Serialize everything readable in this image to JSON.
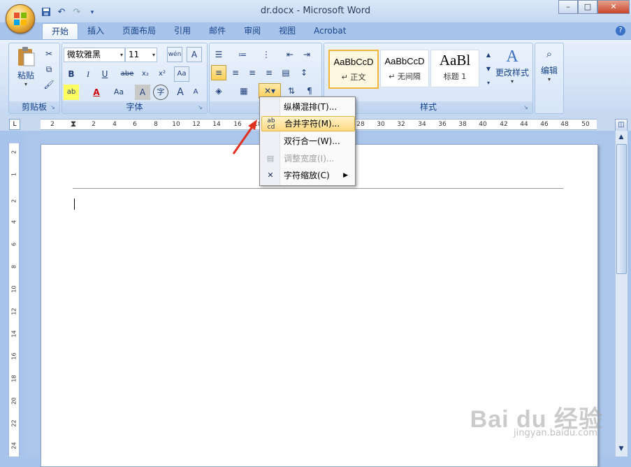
{
  "window": {
    "title": "dr.docx - Microsoft Word",
    "minimize": "0",
    "maximize": "□",
    "close": "✕"
  },
  "quick_access": {
    "save_icon": "save-icon",
    "undo_icon": "undo-icon",
    "redo_icon": "redo-icon",
    "customize_icon": "customize-icon"
  },
  "tabs": [
    {
      "label": "开始",
      "active": true
    },
    {
      "label": "插入"
    },
    {
      "label": "页面布局"
    },
    {
      "label": "引用"
    },
    {
      "label": "邮件"
    },
    {
      "label": "审阅"
    },
    {
      "label": "视图"
    },
    {
      "label": "Acrobat"
    }
  ],
  "ribbon": {
    "clipboard": {
      "label": "剪贴板",
      "paste": "粘贴"
    },
    "font": {
      "label": "字体",
      "font_name": "微软雅黑",
      "font_size": "11",
      "bold": "B",
      "italic": "I",
      "underline": "U",
      "strike": "abe",
      "subscript": "x₂",
      "superscript": "x²",
      "clear": "Aa",
      "char_shading": "A",
      "grow": "A",
      "shrink": "A",
      "wen": "wén",
      "change_case": "Aa",
      "circled": "字"
    },
    "paragraph": {
      "label": "段"
    },
    "styles": {
      "label": "样式",
      "items": [
        {
          "sample": "AaBbCcD",
          "name": "↵ 正文",
          "selected": true
        },
        {
          "sample": "AaBbCcD",
          "name": "↵ 无间隔"
        },
        {
          "sample": "AaBl",
          "name": "标题 1"
        }
      ],
      "change_styles": "更改样式"
    },
    "editing": {
      "label": "编辑"
    }
  },
  "ruler": {
    "corner": "L",
    "ticks": [
      "2",
      "2",
      "4",
      "6",
      "8",
      "10",
      "12",
      "14",
      "16",
      "18",
      "28",
      "30",
      "32",
      "34",
      "36",
      "38",
      "40",
      "42",
      "44",
      "46",
      "48",
      "50"
    ],
    "vticks": [
      "2",
      "1",
      "2",
      "4",
      "6",
      "8",
      "10",
      "12",
      "14",
      "16",
      "18",
      "20",
      "22",
      "24"
    ]
  },
  "menu": {
    "items": [
      {
        "label": "纵横混排(T)...",
        "icon": "vertical-mix-icon"
      },
      {
        "label": "合并字符(M)...",
        "icon": "combine-chars-icon",
        "hover": true
      },
      {
        "label": "双行合一(W)...",
        "icon": "two-lines-icon"
      },
      {
        "label": "调整宽度(I)...",
        "icon": "adjust-width-icon",
        "disabled": true
      },
      {
        "label": "字符缩放(C)",
        "icon": "char-scale-icon",
        "submenu": true
      }
    ]
  },
  "watermark": {
    "text": "Bai du 经验",
    "sub": "jingyan.baidu.com"
  }
}
